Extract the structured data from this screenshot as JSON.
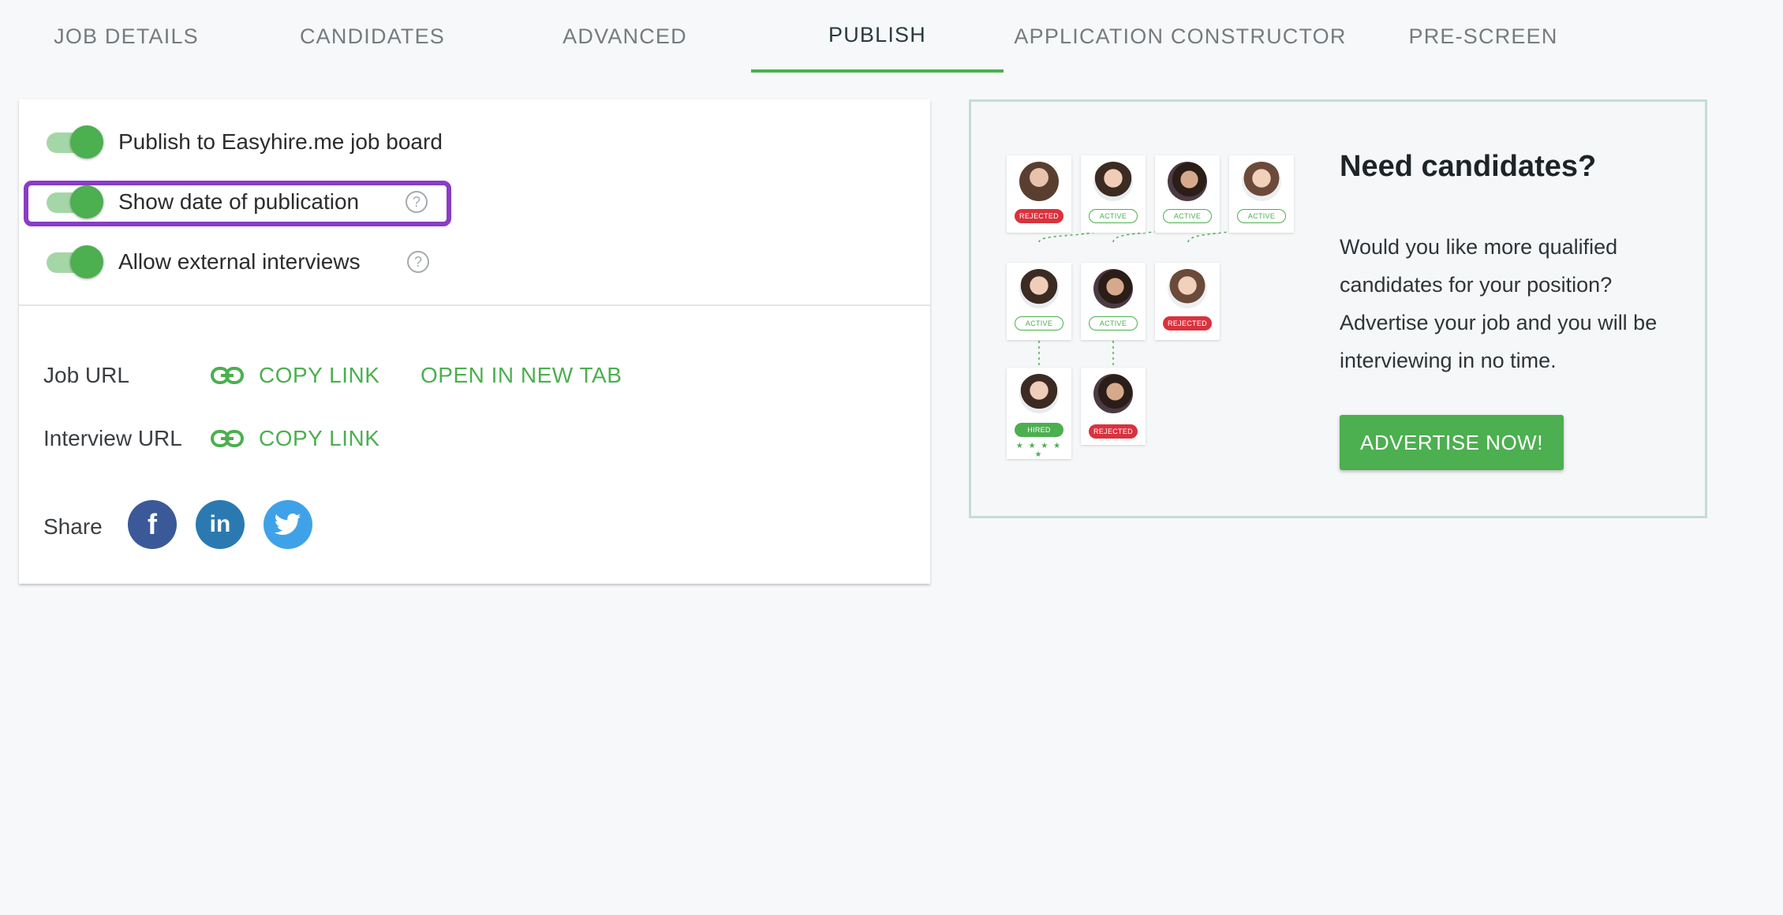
{
  "tabs": [
    {
      "label": "JOB DETAILS"
    },
    {
      "label": "CANDIDATES"
    },
    {
      "label": "ADVANCED"
    },
    {
      "label": "PUBLISH"
    },
    {
      "label": "APPLICATION CONSTRUCTOR"
    },
    {
      "label": "PRE-SCREEN"
    }
  ],
  "active_tab": "PUBLISH",
  "settings": {
    "publish_board": {
      "label": "Publish to Easyhire.me job board",
      "enabled": true
    },
    "show_date": {
      "label": "Show date of publication",
      "enabled": true,
      "help": "?"
    },
    "external_interviews": {
      "label": "Allow external interviews",
      "enabled": true,
      "help": "?"
    }
  },
  "urls": {
    "job_url_label": "Job URL",
    "interview_url_label": "Interview URL",
    "copy_link": "COPY LINK",
    "open_new_tab": "OPEN IN NEW TAB"
  },
  "share": {
    "label": "Share",
    "buttons": [
      {
        "name": "facebook",
        "glyph": "f",
        "color": "#3b5998"
      },
      {
        "name": "linkedin",
        "glyph": "in",
        "color": "#2a7ab1"
      },
      {
        "name": "twitter",
        "glyph": "bird",
        "color": "#3fa2e8"
      }
    ]
  },
  "promo": {
    "title": "Need candidates?",
    "text": "Would you like more qualified candidates for your position? Advertise your job and you will be interviewing in no time.",
    "button": "ADVERTISE NOW!",
    "statuses": {
      "rejected": "REJECTED",
      "active": "ACTIVE",
      "hired": "HIRED"
    },
    "stars": "★ ★ ★ ★ ★"
  },
  "colors": {
    "accent": "#4caf50",
    "highlight": "#8a3cc6",
    "rejected": "#d9323e"
  }
}
